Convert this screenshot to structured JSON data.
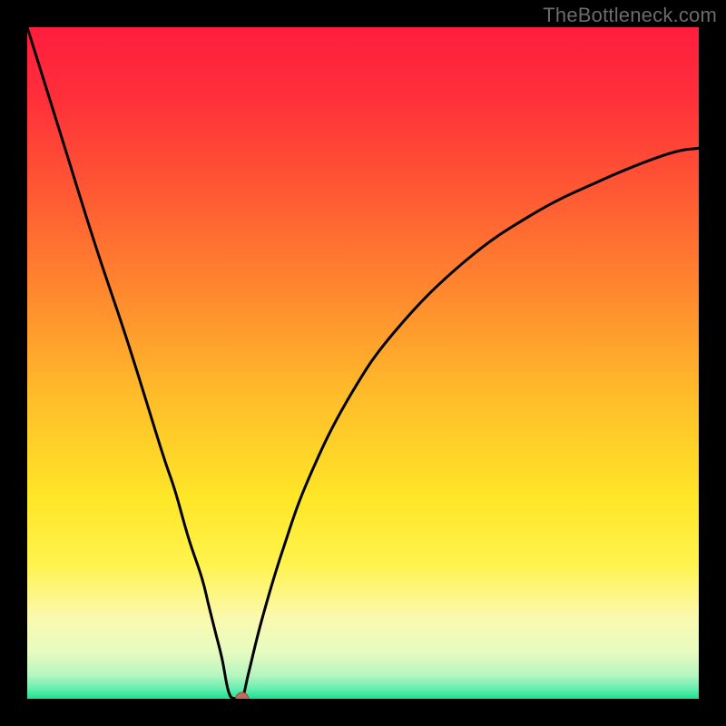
{
  "watermark": "TheBottleneck.com",
  "colors": {
    "frame": "#000000",
    "watermark": "#6b6b6b",
    "curve_stroke": "#000000",
    "marker_fill": "#c36a5d",
    "marker_stroke": "#8e4d43",
    "gradient_stops": [
      {
        "offset": 0.0,
        "color": "#ff1d3f"
      },
      {
        "offset": 0.1,
        "color": "#ff2e3a"
      },
      {
        "offset": 0.25,
        "color": "#ff5a33"
      },
      {
        "offset": 0.4,
        "color": "#ff8a2e"
      },
      {
        "offset": 0.55,
        "color": "#ffbd2a"
      },
      {
        "offset": 0.7,
        "color": "#ffe627"
      },
      {
        "offset": 0.8,
        "color": "#fff34e"
      },
      {
        "offset": 0.88,
        "color": "#fbf9b0"
      },
      {
        "offset": 0.93,
        "color": "#e7fbc0"
      },
      {
        "offset": 0.965,
        "color": "#b6f6c0"
      },
      {
        "offset": 0.985,
        "color": "#67eeb0"
      },
      {
        "offset": 1.0,
        "color": "#19e28f"
      }
    ]
  },
  "chart_data": {
    "type": "line",
    "title": "",
    "xlabel": "",
    "ylabel": "",
    "xlim": [
      0,
      100
    ],
    "ylim": [
      0,
      100
    ],
    "x": [
      0,
      5,
      10,
      15,
      20,
      22,
      24,
      26,
      27,
      28,
      29,
      30,
      31,
      32,
      33,
      35,
      38,
      42,
      48,
      55,
      65,
      75,
      85,
      95,
      100
    ],
    "values": [
      100,
      84,
      68,
      53,
      37,
      31,
      24,
      18,
      14,
      10,
      6,
      1,
      0,
      0,
      4,
      12,
      22,
      33,
      45,
      55,
      65,
      72,
      77,
      81,
      82
    ],
    "marker": {
      "x": 32,
      "y": 0
    },
    "notes": "V-shaped bottleneck curve over vertical heat gradient (red high bottleneck at top, green low bottleneck at bottom). Minimum near x≈31–32 at y≈0. Values estimated from pixel positions; no axis ticks or labels are visible in the image."
  }
}
